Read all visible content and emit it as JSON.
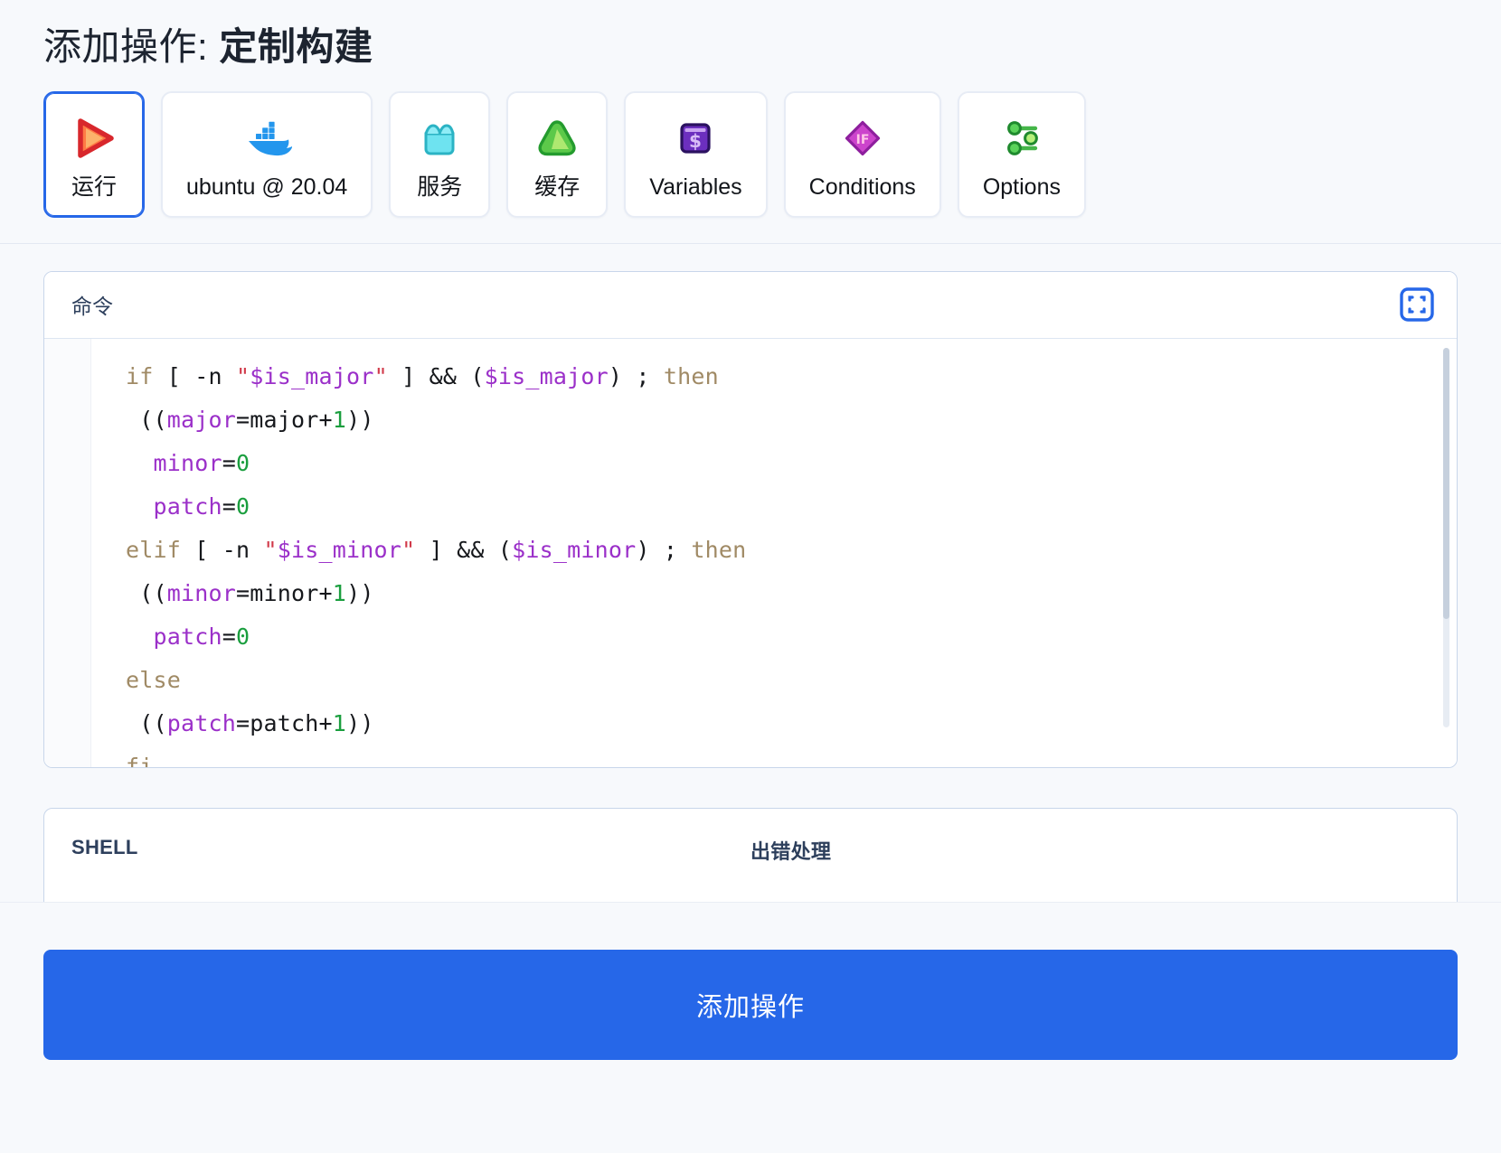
{
  "header": {
    "title_prefix": "添加操作: ",
    "title_strong": "定制构建"
  },
  "tabs": [
    {
      "label": "运行",
      "icon": "play-triangle-icon",
      "selected": true
    },
    {
      "label": "ubuntu @ 20.04",
      "icon": "docker-whale-icon",
      "selected": false
    },
    {
      "label": "服务",
      "icon": "services-container-icon",
      "selected": false
    },
    {
      "label": "缓存",
      "icon": "cache-triangle-icon",
      "selected": false
    },
    {
      "label": "Variables",
      "icon": "variables-dollar-icon",
      "selected": false
    },
    {
      "label": "Conditions",
      "icon": "conditions-if-diamond-icon",
      "selected": false
    },
    {
      "label": "Options",
      "icon": "options-sliders-icon",
      "selected": false
    }
  ],
  "command_card": {
    "label": "命令",
    "expand_icon": "fullscreen-icon",
    "code_lines": [
      [
        {
          "t": "if ",
          "c": "kw"
        },
        {
          "t": "[ -n ",
          "c": "pl"
        },
        {
          "t": "\"",
          "c": "str"
        },
        {
          "t": "$is_major",
          "c": "var"
        },
        {
          "t": "\"",
          "c": "str"
        },
        {
          "t": " ] && (",
          "c": "pl"
        },
        {
          "t": "$is_major",
          "c": "var"
        },
        {
          "t": ") ; ",
          "c": "pl"
        },
        {
          "t": "then",
          "c": "kw"
        }
      ],
      [
        {
          "t": " ((",
          "c": "pl"
        },
        {
          "t": "major",
          "c": "var"
        },
        {
          "t": "=major+",
          "c": "pl"
        },
        {
          "t": "1",
          "c": "num"
        },
        {
          "t": "))",
          "c": "pl"
        }
      ],
      [
        {
          "t": "  ",
          "c": "pl"
        },
        {
          "t": "minor",
          "c": "var"
        },
        {
          "t": "=",
          "c": "pl"
        },
        {
          "t": "0",
          "c": "num"
        }
      ],
      [
        {
          "t": "  ",
          "c": "pl"
        },
        {
          "t": "patch",
          "c": "var"
        },
        {
          "t": "=",
          "c": "pl"
        },
        {
          "t": "0",
          "c": "num"
        }
      ],
      [
        {
          "t": "elif ",
          "c": "kw"
        },
        {
          "t": "[ -n ",
          "c": "pl"
        },
        {
          "t": "\"",
          "c": "str"
        },
        {
          "t": "$is_minor",
          "c": "var"
        },
        {
          "t": "\"",
          "c": "str"
        },
        {
          "t": " ] && (",
          "c": "pl"
        },
        {
          "t": "$is_minor",
          "c": "var"
        },
        {
          "t": ") ; ",
          "c": "pl"
        },
        {
          "t": "then",
          "c": "kw"
        }
      ],
      [
        {
          "t": " ((",
          "c": "pl"
        },
        {
          "t": "minor",
          "c": "var"
        },
        {
          "t": "=minor+",
          "c": "pl"
        },
        {
          "t": "1",
          "c": "num"
        },
        {
          "t": "))",
          "c": "pl"
        }
      ],
      [
        {
          "t": "  ",
          "c": "pl"
        },
        {
          "t": "patch",
          "c": "var"
        },
        {
          "t": "=",
          "c": "pl"
        },
        {
          "t": "0",
          "c": "num"
        }
      ],
      [
        {
          "t": "else",
          "c": "kw"
        }
      ],
      [
        {
          "t": " ((",
          "c": "pl"
        },
        {
          "t": "patch",
          "c": "var"
        },
        {
          "t": "=patch+",
          "c": "pl"
        },
        {
          "t": "1",
          "c": "num"
        },
        {
          "t": "))",
          "c": "pl"
        }
      ],
      [
        {
          "t": "fi",
          "c": "kw"
        }
      ]
    ]
  },
  "options_card": {
    "shell_label": "SHELL",
    "error_label": "出错处理"
  },
  "footer": {
    "submit_label": "添加操作"
  },
  "colors": {
    "accent": "#2667e8",
    "page_bg": "#f7f9fc",
    "card_border": "#c8d6ea",
    "label": "#2d3f5c",
    "code_keyword": "#a08a65",
    "code_variable": "#9b30c9",
    "code_string": "#d13a4a",
    "code_number": "#1a9e3e"
  }
}
